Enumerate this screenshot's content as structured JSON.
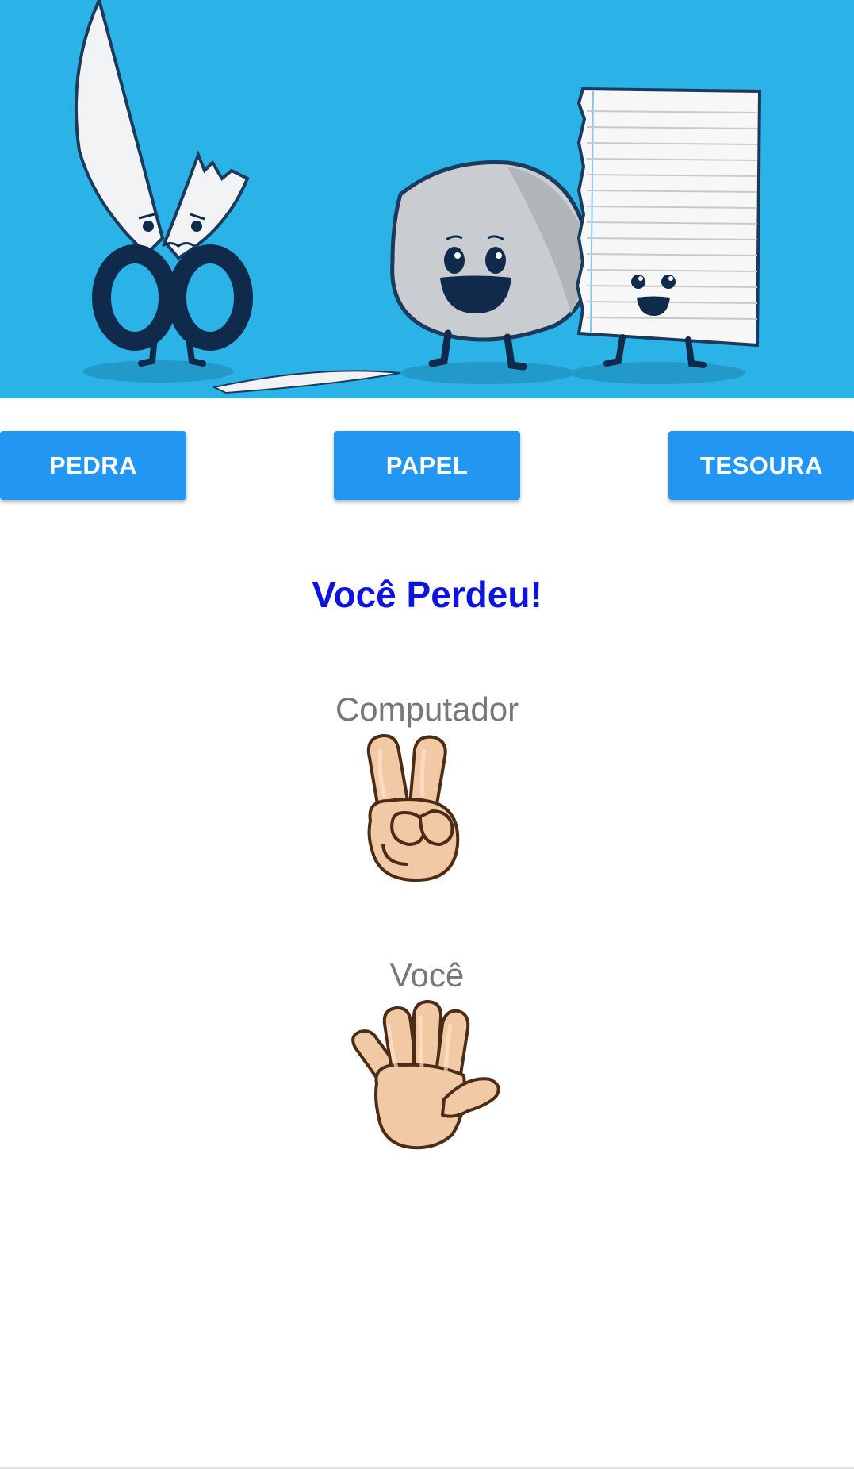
{
  "banner": {
    "icon": "rock-paper-scissors-banner-illustration",
    "background_color": "#2bb2e6"
  },
  "buttons": {
    "rock_label": "PEDRA",
    "paper_label": "PAPEL",
    "scissors_label": "TESOURA",
    "color": "#2196f3"
  },
  "result": {
    "text": "Você Perdeu!",
    "color": "#0d14e0"
  },
  "computer": {
    "label": "Computador",
    "choice_icon": "scissors-hand-icon"
  },
  "player": {
    "label": "Você",
    "choice_icon": "paper-hand-icon"
  }
}
